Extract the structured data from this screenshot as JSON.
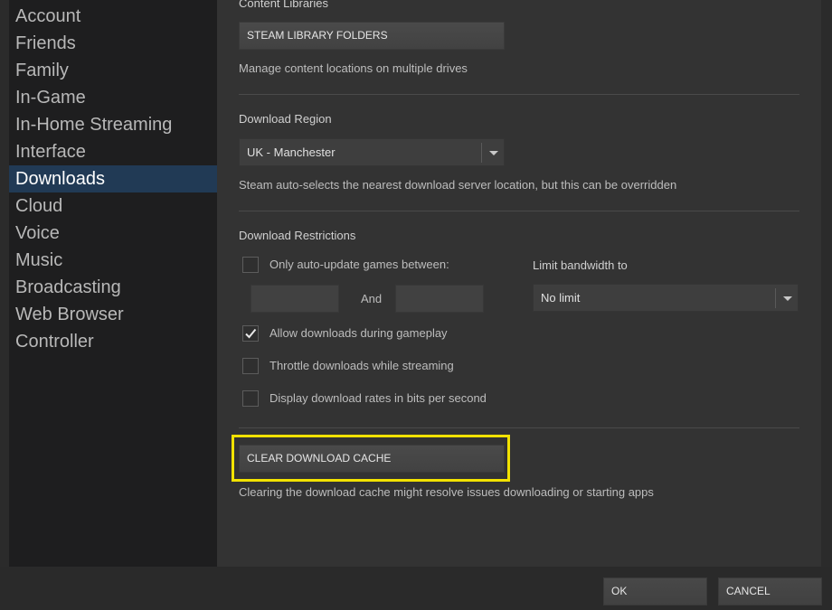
{
  "sidebar": {
    "items": [
      {
        "label": "Account"
      },
      {
        "label": "Friends"
      },
      {
        "label": "Family"
      },
      {
        "label": "In-Game"
      },
      {
        "label": "In-Home Streaming"
      },
      {
        "label": "Interface"
      },
      {
        "label": "Downloads",
        "active": true
      },
      {
        "label": "Cloud"
      },
      {
        "label": "Voice"
      },
      {
        "label": "Music"
      },
      {
        "label": "Broadcasting"
      },
      {
        "label": "Web Browser"
      },
      {
        "label": "Controller"
      }
    ]
  },
  "content_libraries": {
    "title": "Content Libraries",
    "button_label": "STEAM LIBRARY FOLDERS",
    "description": "Manage content locations on multiple drives"
  },
  "download_region": {
    "title": "Download Region",
    "selected": "UK - Manchester",
    "description": "Steam auto-selects the nearest download server location, but this can be overridden"
  },
  "download_restrictions": {
    "title": "Download Restrictions",
    "auto_update_label": "Only auto-update games between:",
    "auto_update_checked": false,
    "and_label": "And",
    "bandwidth_label": "Limit bandwidth to",
    "bandwidth_selected": "No limit",
    "allow_gameplay_label": "Allow downloads during gameplay",
    "allow_gameplay_checked": true,
    "throttle_label": "Throttle downloads while streaming",
    "throttle_checked": false,
    "bits_label": "Display download rates in bits per second",
    "bits_checked": false
  },
  "cache": {
    "button_label": "CLEAR DOWNLOAD CACHE",
    "description": "Clearing the download cache might resolve issues downloading or starting apps"
  },
  "footer": {
    "ok_label": "OK",
    "cancel_label": "CANCEL"
  },
  "colors": {
    "highlight": "#f2e200",
    "active_nav": "#213a55"
  }
}
